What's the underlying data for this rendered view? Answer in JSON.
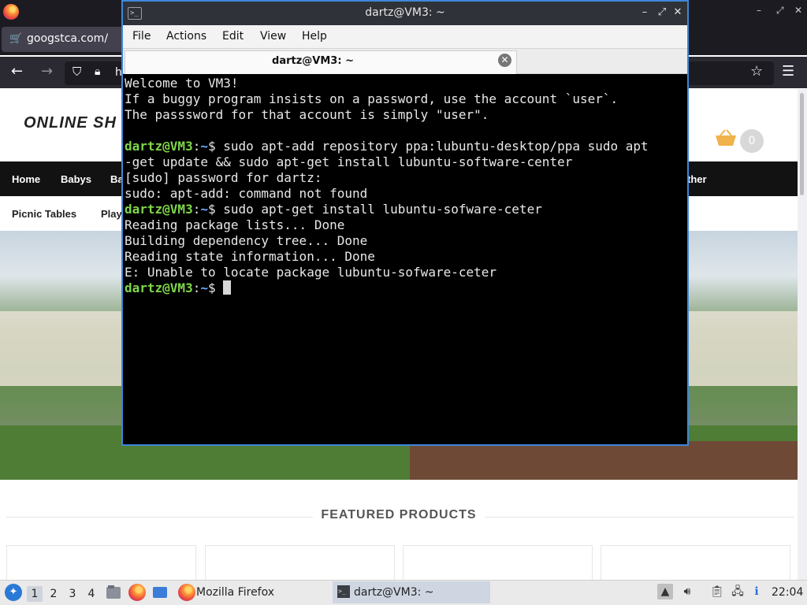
{
  "firefox": {
    "tab_title": "googstca.com/",
    "url_partial": "h",
    "taskbar_label": "Mozilla Firefox"
  },
  "shop": {
    "logo_first": "ONLINE SH",
    "cart_count": "0",
    "nav_row1": [
      {
        "label": "Home"
      },
      {
        "label": "Babys"
      },
      {
        "label": "Ba"
      },
      {
        "label": "ther"
      }
    ],
    "nav_row2": [
      {
        "label": "Picnic Tables"
      },
      {
        "label": "Play"
      }
    ],
    "featured_heading": "FEATURED PRODUCTS"
  },
  "terminal": {
    "window_title": "dartz@VM3: ~",
    "tab_title": "dartz@VM3: ~",
    "menu": [
      "File",
      "Actions",
      "Edit",
      "View",
      "Help"
    ],
    "prompt_user": "dartz@VM3",
    "prompt_sep": ":",
    "prompt_path": "~",
    "prompt_dollar": "$ ",
    "lines": [
      {
        "type": "out",
        "text": "Welcome to VM3!"
      },
      {
        "type": "out",
        "text": "If a buggy program insists on a password, use the account `user`."
      },
      {
        "type": "out",
        "text": "The passsword for that account is simply \"user\"."
      },
      {
        "type": "out",
        "text": ""
      },
      {
        "type": "cmd",
        "text": "sudo apt-add repository ppa:lubuntu-desktop/ppa sudo apt"
      },
      {
        "type": "out",
        "text": "-get update && sudo apt-get install lubuntu-software-center"
      },
      {
        "type": "out",
        "text": "[sudo] password for dartz:"
      },
      {
        "type": "out",
        "text": "sudo: apt-add: command not found"
      },
      {
        "type": "cmd",
        "text": "sudo apt-get install lubuntu-sofware-ceter"
      },
      {
        "type": "out",
        "text": "Reading package lists... Done"
      },
      {
        "type": "out",
        "text": "Building dependency tree... Done"
      },
      {
        "type": "out",
        "text": "Reading state information... Done"
      },
      {
        "type": "out",
        "text": "E: Unable to locate package lubuntu-sofware-ceter"
      },
      {
        "type": "cursor",
        "text": ""
      }
    ]
  },
  "taskbar": {
    "workspaces": [
      "1",
      "2",
      "3",
      "4"
    ],
    "active_workspace": "1",
    "tasks": [
      {
        "label": "Mozilla Firefox",
        "icon": "firefox-icon"
      },
      {
        "label": "dartz@VM3: ~",
        "icon": "terminal-icon"
      }
    ],
    "clock": "22:04"
  }
}
